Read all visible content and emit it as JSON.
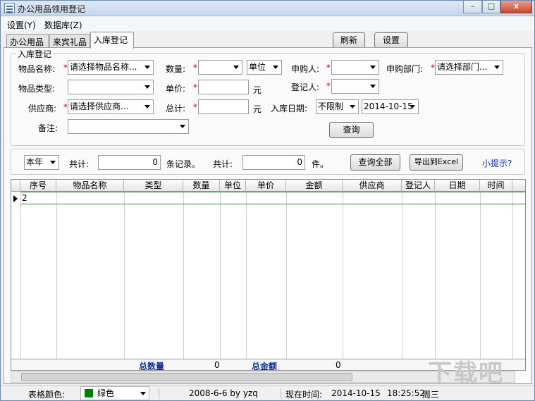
{
  "window": {
    "title": "办公用品领用登记",
    "controls": [
      "–",
      "□",
      "x"
    ]
  },
  "menu": [
    "设置(Y)",
    "数据库(Z)"
  ],
  "tabs": [
    "办公用品",
    "来宾礼品",
    "入库登记"
  ],
  "toolbar": {
    "refresh": "刷新",
    "settings": "设置"
  },
  "form": {
    "group_title": "入库登记",
    "item_name": {
      "label": "物品名称:",
      "value": "请选择物品名称..."
    },
    "quantity": {
      "label": "数量:",
      "value": ""
    },
    "unit": {
      "value": "单位"
    },
    "requester": {
      "label": "申购人:",
      "value": ""
    },
    "department": {
      "label": "申购部门:",
      "value": "请选择部门..."
    },
    "item_type": {
      "label": "物品类型:",
      "value": ""
    },
    "unit_price": {
      "label": "单价:",
      "value": "",
      "suffix": "元"
    },
    "registrar": {
      "label": "登记人:",
      "value": ""
    },
    "supplier": {
      "label": "供应商:",
      "value": "请选择供应商..."
    },
    "total": {
      "label": "总计:",
      "value": "",
      "suffix": "元"
    },
    "date_filter": {
      "label": "入库日期:",
      "mode": "不限制",
      "date": "2014-10-15"
    },
    "remark": {
      "label": "备注:",
      "value": ""
    },
    "star": "*",
    "query_button": "查询"
  },
  "summary_bar": {
    "period": "本年",
    "total_label": "共计:",
    "records_value": "0",
    "records_suffix": "条记录。",
    "total_label2": "共计:",
    "items_value": "0",
    "items_suffix": "件。",
    "query_all": "查询全部",
    "export_excel": "导出到Excel",
    "tip": "小提示?"
  },
  "grid": {
    "columns": [
      "序号",
      "物品名称",
      "类型",
      "数量",
      "单位",
      "单价",
      "金额",
      "供应商",
      "登记人",
      "日期",
      "时间"
    ],
    "first_row_seq": "2",
    "totals": {
      "qty_label": "总数量",
      "qty_value": "0",
      "amount_label": "总金额",
      "amount_value": "0"
    }
  },
  "status": {
    "grid_color_label": "表格颜色:",
    "grid_color_value": "绿色",
    "grid_color_hex": "#008000",
    "credit": "2008-6-6 by yzq",
    "now_label": "现在时间:",
    "now_date": "2014-10-15",
    "now_time": "18:25:52",
    "weekday": "周三"
  },
  "watermark": "下载吧"
}
